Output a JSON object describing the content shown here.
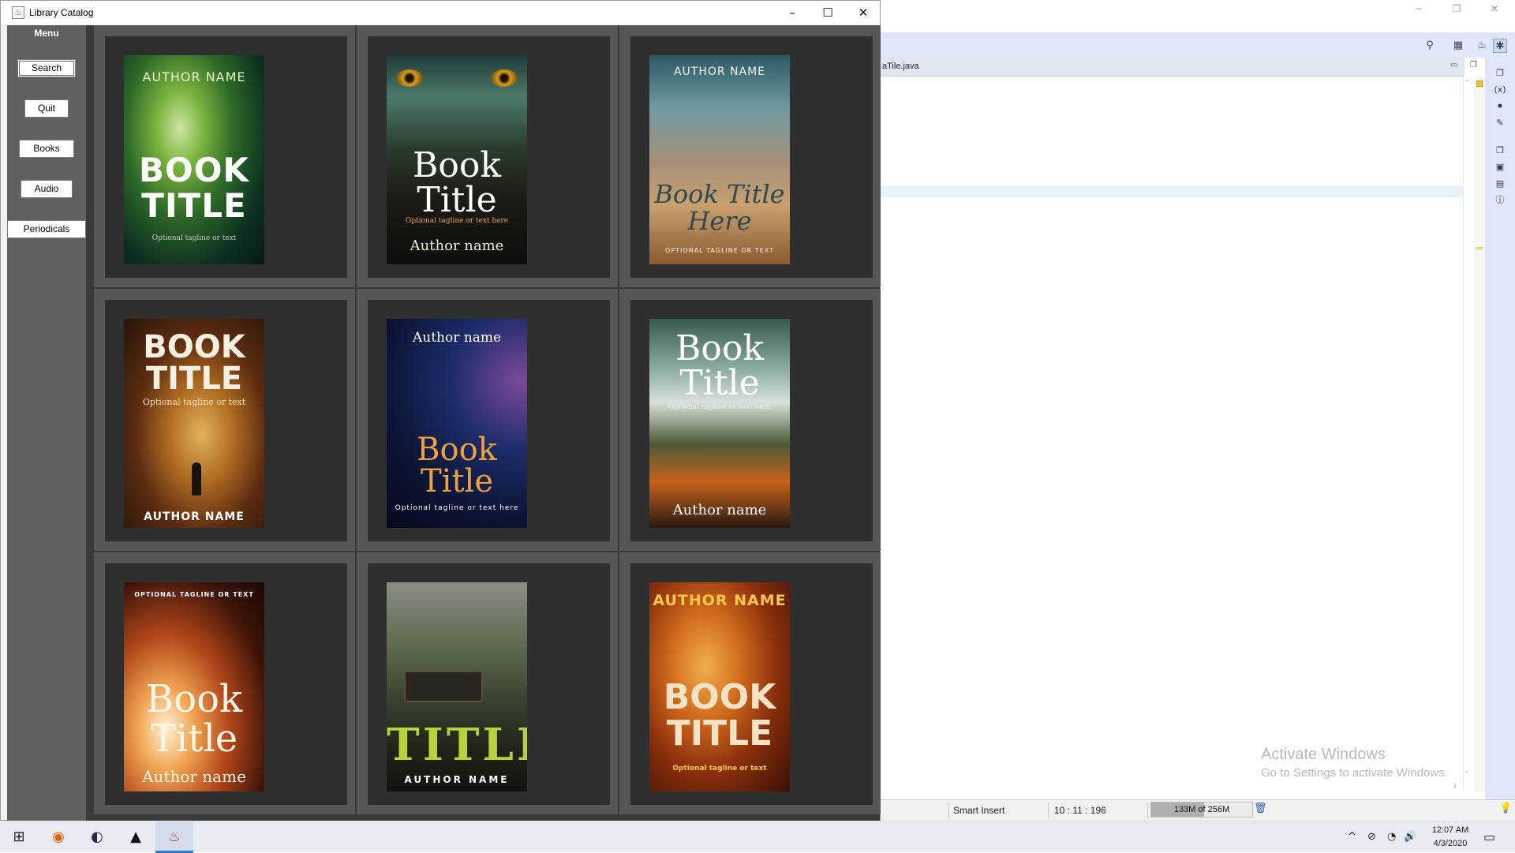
{
  "app_window": {
    "title": "Library Catalog",
    "controls": {
      "minimize": "–",
      "maximize": "☐",
      "close": "✕"
    }
  },
  "sidebar": {
    "heading": "Menu",
    "buttons": [
      {
        "id": "search",
        "label": "Search"
      },
      {
        "id": "quit",
        "label": "Quit"
      },
      {
        "id": "books",
        "label": "Books"
      },
      {
        "id": "audio",
        "label": "Audio"
      },
      {
        "id": "periodicals",
        "label": "Periodicals"
      }
    ]
  },
  "covers": [
    {
      "top": "AUTHOR NAME",
      "title1": "BOOK",
      "title2": "TITLE",
      "tagline": "Optional tagline or text",
      "author": ""
    },
    {
      "top": "",
      "title1": "Book",
      "title2": "Title",
      "tagline": "Optional tagline or text here",
      "author": "Author name"
    },
    {
      "top": "AUTHOR NAME",
      "title1": "Book Title",
      "title2": "Here",
      "tagline": "OPTIONAL TAGLINE OR TEXT",
      "author": ""
    },
    {
      "top": "",
      "title1": "BOOK",
      "title2": "TITLE",
      "tagline": "Optional tagline or text",
      "author": "AUTHOR NAME"
    },
    {
      "top": "Author name",
      "title1": "Book",
      "title2": "Title",
      "tagline": "Optional tagline or text here",
      "author": ""
    },
    {
      "top": "",
      "title1": "Book",
      "title2": "Title",
      "tagline": "Optional tagline or text here",
      "author": "Author name"
    },
    {
      "top": "OPTIONAL TAGLINE OR TEXT",
      "title1": "Book",
      "title2": "Title",
      "tagline": "",
      "author": "Author name"
    },
    {
      "top": "",
      "title1": "",
      "title2": "TITLE",
      "tagline": "",
      "author": "AUTHOR NAME"
    },
    {
      "top": "AUTHOR NAME",
      "title1": "BOOK",
      "title2": "TITLE",
      "tagline": "Optional tagline or text",
      "author": ""
    }
  ],
  "ide": {
    "editor_tab": "aTile.java",
    "status": {
      "insert_mode": "Smart Insert",
      "position": "10 : 11 : 196",
      "heap": "133M of 256M",
      "heap_used_fraction": 0.52
    }
  },
  "watermark": {
    "title": "Activate Windows",
    "subtitle": "Go to Settings to activate Windows."
  },
  "taskbar": {
    "time": "12:07 AM",
    "date": "4/3/2020"
  },
  "colors": {
    "sidebar": "#606060",
    "grid_bg": "#3a3a3a",
    "cell_frame": "#565656",
    "cell_inner": "#2f2f2f",
    "ide_toolbar": "#e1e6f6"
  }
}
